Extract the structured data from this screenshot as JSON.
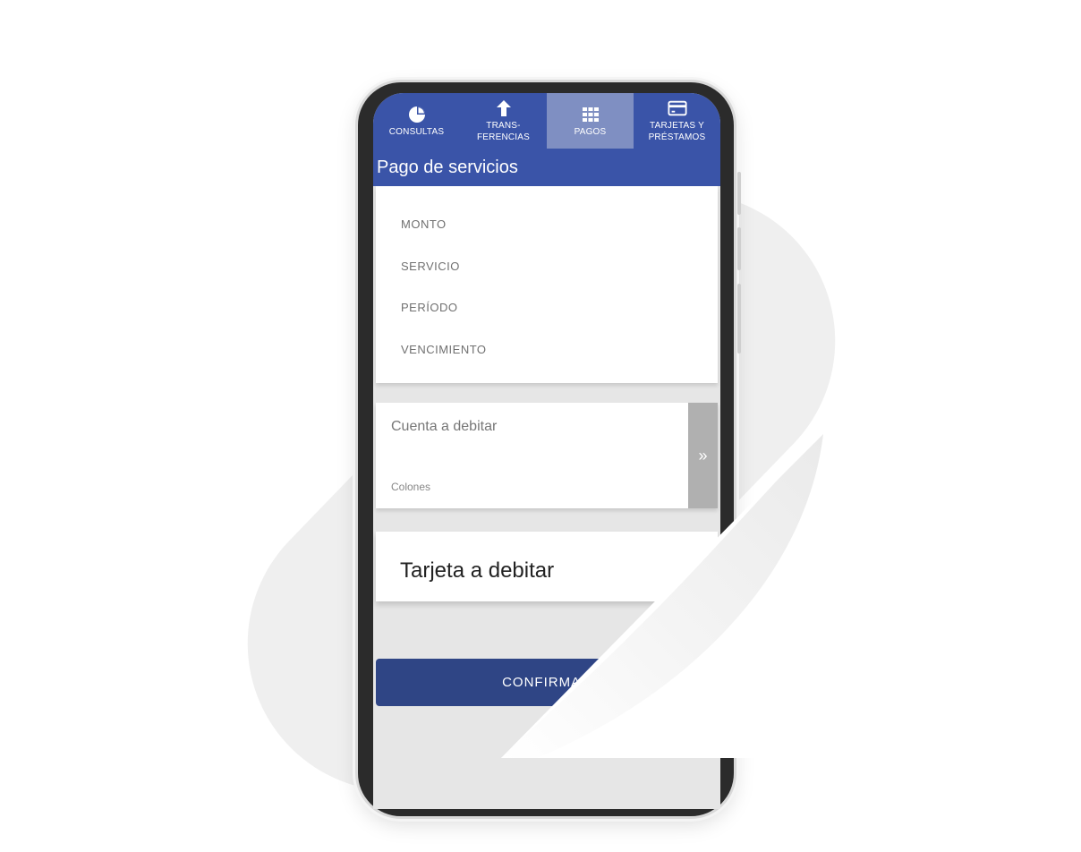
{
  "nav": {
    "items": [
      {
        "label": "CONSULTAS",
        "icon": "pie-chart-icon"
      },
      {
        "label": "TRANS-\nFERENCIAS",
        "icon": "arrow-up-icon"
      },
      {
        "label": "PAGOS",
        "icon": "grid-icon"
      },
      {
        "label": "TARJETAS Y\nPRÉSTAMOS",
        "icon": "credit-card-icon"
      }
    ],
    "active": "PAGOS"
  },
  "page": {
    "title": "Pago de servicios"
  },
  "details": {
    "fields": [
      "MONTO",
      "SERVICIO",
      "PERÍODO",
      "VENCIMIENTO"
    ]
  },
  "account": {
    "title": "Cuenta a debitar",
    "currency": "Colones",
    "arrow": "»"
  },
  "card_section": {
    "title": "Tarjeta a debitar"
  },
  "confirm": {
    "label": "CONFIRMAR"
  },
  "colors": {
    "primary": "#3a54a8",
    "nav_active": "#7f8fc2",
    "button": "#2f4585",
    "background_blob": "#efefef"
  }
}
